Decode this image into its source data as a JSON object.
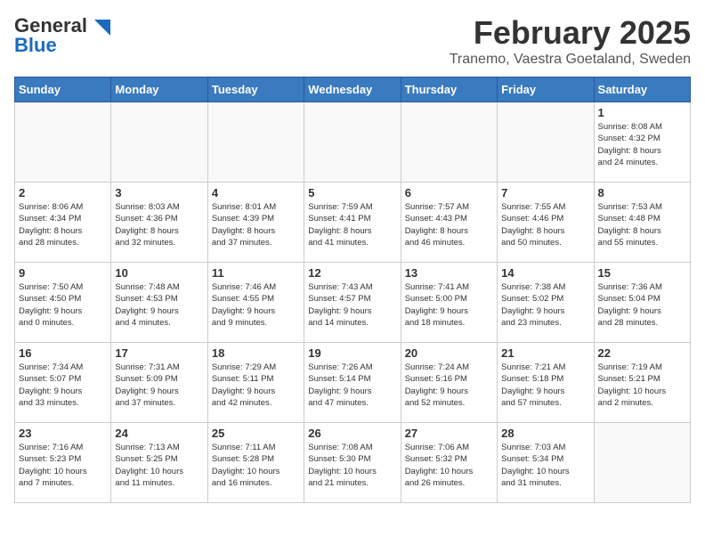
{
  "header": {
    "logo_general": "General",
    "logo_blue": "Blue",
    "month_title": "February 2025",
    "location": "Tranemo, Vaestra Goetaland, Sweden"
  },
  "weekdays": [
    "Sunday",
    "Monday",
    "Tuesday",
    "Wednesday",
    "Thursday",
    "Friday",
    "Saturday"
  ],
  "weeks": [
    [
      {
        "day": "",
        "info": ""
      },
      {
        "day": "",
        "info": ""
      },
      {
        "day": "",
        "info": ""
      },
      {
        "day": "",
        "info": ""
      },
      {
        "day": "",
        "info": ""
      },
      {
        "day": "",
        "info": ""
      },
      {
        "day": "1",
        "info": "Sunrise: 8:08 AM\nSunset: 4:32 PM\nDaylight: 8 hours\nand 24 minutes."
      }
    ],
    [
      {
        "day": "2",
        "info": "Sunrise: 8:06 AM\nSunset: 4:34 PM\nDaylight: 8 hours\nand 28 minutes."
      },
      {
        "day": "3",
        "info": "Sunrise: 8:03 AM\nSunset: 4:36 PM\nDaylight: 8 hours\nand 32 minutes."
      },
      {
        "day": "4",
        "info": "Sunrise: 8:01 AM\nSunset: 4:39 PM\nDaylight: 8 hours\nand 37 minutes."
      },
      {
        "day": "5",
        "info": "Sunrise: 7:59 AM\nSunset: 4:41 PM\nDaylight: 8 hours\nand 41 minutes."
      },
      {
        "day": "6",
        "info": "Sunrise: 7:57 AM\nSunset: 4:43 PM\nDaylight: 8 hours\nand 46 minutes."
      },
      {
        "day": "7",
        "info": "Sunrise: 7:55 AM\nSunset: 4:46 PM\nDaylight: 8 hours\nand 50 minutes."
      },
      {
        "day": "8",
        "info": "Sunrise: 7:53 AM\nSunset: 4:48 PM\nDaylight: 8 hours\nand 55 minutes."
      }
    ],
    [
      {
        "day": "9",
        "info": "Sunrise: 7:50 AM\nSunset: 4:50 PM\nDaylight: 9 hours\nand 0 minutes."
      },
      {
        "day": "10",
        "info": "Sunrise: 7:48 AM\nSunset: 4:53 PM\nDaylight: 9 hours\nand 4 minutes."
      },
      {
        "day": "11",
        "info": "Sunrise: 7:46 AM\nSunset: 4:55 PM\nDaylight: 9 hours\nand 9 minutes."
      },
      {
        "day": "12",
        "info": "Sunrise: 7:43 AM\nSunset: 4:57 PM\nDaylight: 9 hours\nand 14 minutes."
      },
      {
        "day": "13",
        "info": "Sunrise: 7:41 AM\nSunset: 5:00 PM\nDaylight: 9 hours\nand 18 minutes."
      },
      {
        "day": "14",
        "info": "Sunrise: 7:38 AM\nSunset: 5:02 PM\nDaylight: 9 hours\nand 23 minutes."
      },
      {
        "day": "15",
        "info": "Sunrise: 7:36 AM\nSunset: 5:04 PM\nDaylight: 9 hours\nand 28 minutes."
      }
    ],
    [
      {
        "day": "16",
        "info": "Sunrise: 7:34 AM\nSunset: 5:07 PM\nDaylight: 9 hours\nand 33 minutes."
      },
      {
        "day": "17",
        "info": "Sunrise: 7:31 AM\nSunset: 5:09 PM\nDaylight: 9 hours\nand 37 minutes."
      },
      {
        "day": "18",
        "info": "Sunrise: 7:29 AM\nSunset: 5:11 PM\nDaylight: 9 hours\nand 42 minutes."
      },
      {
        "day": "19",
        "info": "Sunrise: 7:26 AM\nSunset: 5:14 PM\nDaylight: 9 hours\nand 47 minutes."
      },
      {
        "day": "20",
        "info": "Sunrise: 7:24 AM\nSunset: 5:16 PM\nDaylight: 9 hours\nand 52 minutes."
      },
      {
        "day": "21",
        "info": "Sunrise: 7:21 AM\nSunset: 5:18 PM\nDaylight: 9 hours\nand 57 minutes."
      },
      {
        "day": "22",
        "info": "Sunrise: 7:19 AM\nSunset: 5:21 PM\nDaylight: 10 hours\nand 2 minutes."
      }
    ],
    [
      {
        "day": "23",
        "info": "Sunrise: 7:16 AM\nSunset: 5:23 PM\nDaylight: 10 hours\nand 7 minutes."
      },
      {
        "day": "24",
        "info": "Sunrise: 7:13 AM\nSunset: 5:25 PM\nDaylight: 10 hours\nand 11 minutes."
      },
      {
        "day": "25",
        "info": "Sunrise: 7:11 AM\nSunset: 5:28 PM\nDaylight: 10 hours\nand 16 minutes."
      },
      {
        "day": "26",
        "info": "Sunrise: 7:08 AM\nSunset: 5:30 PM\nDaylight: 10 hours\nand 21 minutes."
      },
      {
        "day": "27",
        "info": "Sunrise: 7:06 AM\nSunset: 5:32 PM\nDaylight: 10 hours\nand 26 minutes."
      },
      {
        "day": "28",
        "info": "Sunrise: 7:03 AM\nSunset: 5:34 PM\nDaylight: 10 hours\nand 31 minutes."
      },
      {
        "day": "",
        "info": ""
      }
    ]
  ]
}
